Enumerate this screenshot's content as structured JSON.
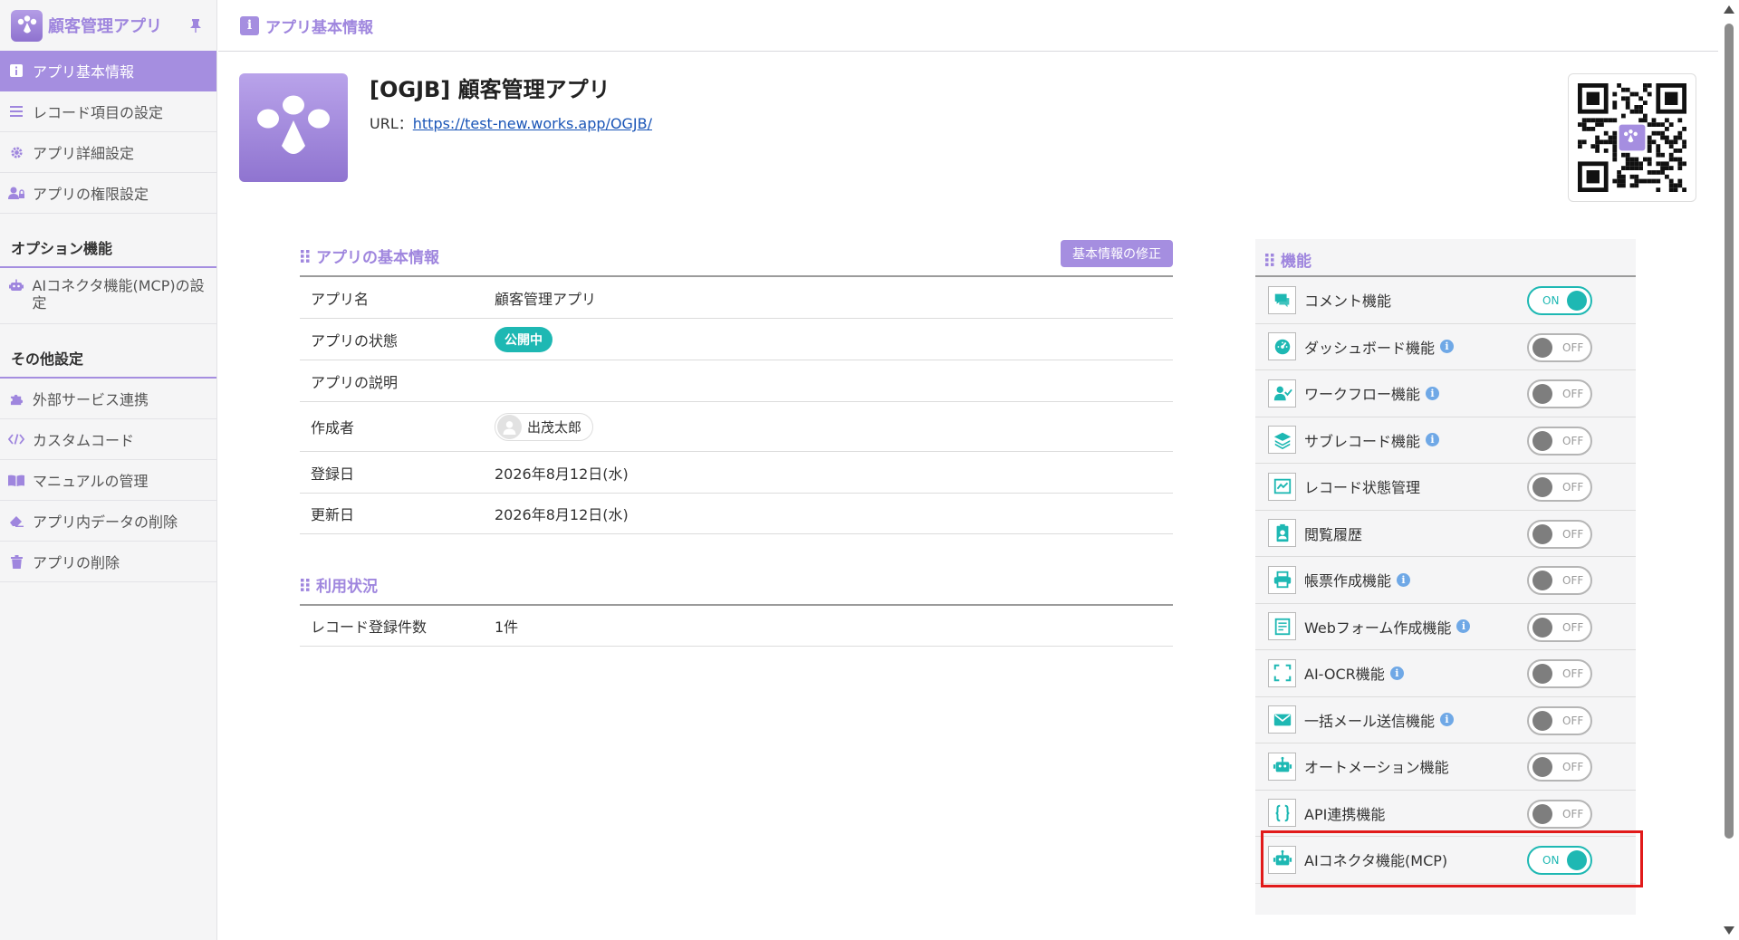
{
  "sidebar": {
    "brand": "顧客管理アプリ",
    "items": [
      {
        "label": "アプリ基本情報",
        "icon": "info-icon"
      },
      {
        "label": "レコード項目の設定",
        "icon": "list-icon"
      },
      {
        "label": "アプリ詳細設定",
        "icon": "gear-icon"
      },
      {
        "label": "アプリの権限設定",
        "icon": "users-lock-icon"
      }
    ],
    "section_options": "オプション機能",
    "option_items": [
      {
        "label": "AIコネクタ機能(MCP)の設定",
        "icon": "robot-icon"
      }
    ],
    "section_other": "その他設定",
    "other_items": [
      {
        "label": "外部サービス連携",
        "icon": "puzzle-icon"
      },
      {
        "label": "カスタムコード",
        "icon": "code-icon"
      },
      {
        "label": "マニュアルの管理",
        "icon": "book-icon"
      },
      {
        "label": "アプリ内データの削除",
        "icon": "eraser-icon"
      },
      {
        "label": "アプリの削除",
        "icon": "trash-icon"
      }
    ]
  },
  "header": {
    "title": "アプリ基本情報"
  },
  "app": {
    "title": "[OGJB] 顧客管理アプリ",
    "url_label": "URL：",
    "url": "https://test-new.works.app/OGJB/"
  },
  "basic_info": {
    "title": "アプリの基本情報",
    "edit_button": "基本情報の修正",
    "rows": [
      {
        "key": "アプリ名",
        "value": "顧客管理アプリ"
      },
      {
        "key": "アプリの状態",
        "value": "公開中"
      },
      {
        "key": "アプリの説明",
        "value": ""
      },
      {
        "key": "作成者",
        "value": "出茂太郎"
      },
      {
        "key": "登録日",
        "value": "2026年8月12日(水)"
      },
      {
        "key": "更新日",
        "value": "2026年8月12日(水)"
      }
    ]
  },
  "usage": {
    "title": "利用状況",
    "rows": [
      {
        "key": "レコード登録件数",
        "value": "1件"
      }
    ]
  },
  "features": {
    "title": "機能",
    "items": [
      {
        "label": "コメント機能",
        "info": false,
        "state": "ON",
        "icon": "comment-icon"
      },
      {
        "label": "ダッシュボード機能",
        "info": true,
        "state": "OFF",
        "icon": "dashboard-icon"
      },
      {
        "label": "ワークフロー機能",
        "info": true,
        "state": "OFF",
        "icon": "workflow-icon"
      },
      {
        "label": "サブレコード機能",
        "info": true,
        "state": "OFF",
        "icon": "layers-icon"
      },
      {
        "label": "レコード状態管理",
        "info": false,
        "state": "OFF",
        "icon": "status-icon"
      },
      {
        "label": "閲覧履歴",
        "info": false,
        "state": "OFF",
        "icon": "badge-icon"
      },
      {
        "label": "帳票作成機能",
        "info": true,
        "state": "OFF",
        "icon": "print-icon"
      },
      {
        "label": "Webフォーム作成機能",
        "info": true,
        "state": "OFF",
        "icon": "form-icon"
      },
      {
        "label": "AI-OCR機能",
        "info": true,
        "state": "OFF",
        "icon": "scan-icon"
      },
      {
        "label": "一括メール送信機能",
        "info": true,
        "state": "OFF",
        "icon": "mail-icon"
      },
      {
        "label": "オートメーション機能",
        "info": false,
        "state": "OFF",
        "icon": "robot-icon"
      },
      {
        "label": "API連携機能",
        "info": false,
        "state": "OFF",
        "icon": "braces-icon"
      },
      {
        "label": "AIコネクタ機能(MCP)",
        "info": false,
        "state": "ON",
        "icon": "robot-icon"
      }
    ]
  },
  "colors": {
    "accent": "#a58ee0",
    "teal": "#1eb8b3",
    "highlight": "#e11a1a"
  }
}
